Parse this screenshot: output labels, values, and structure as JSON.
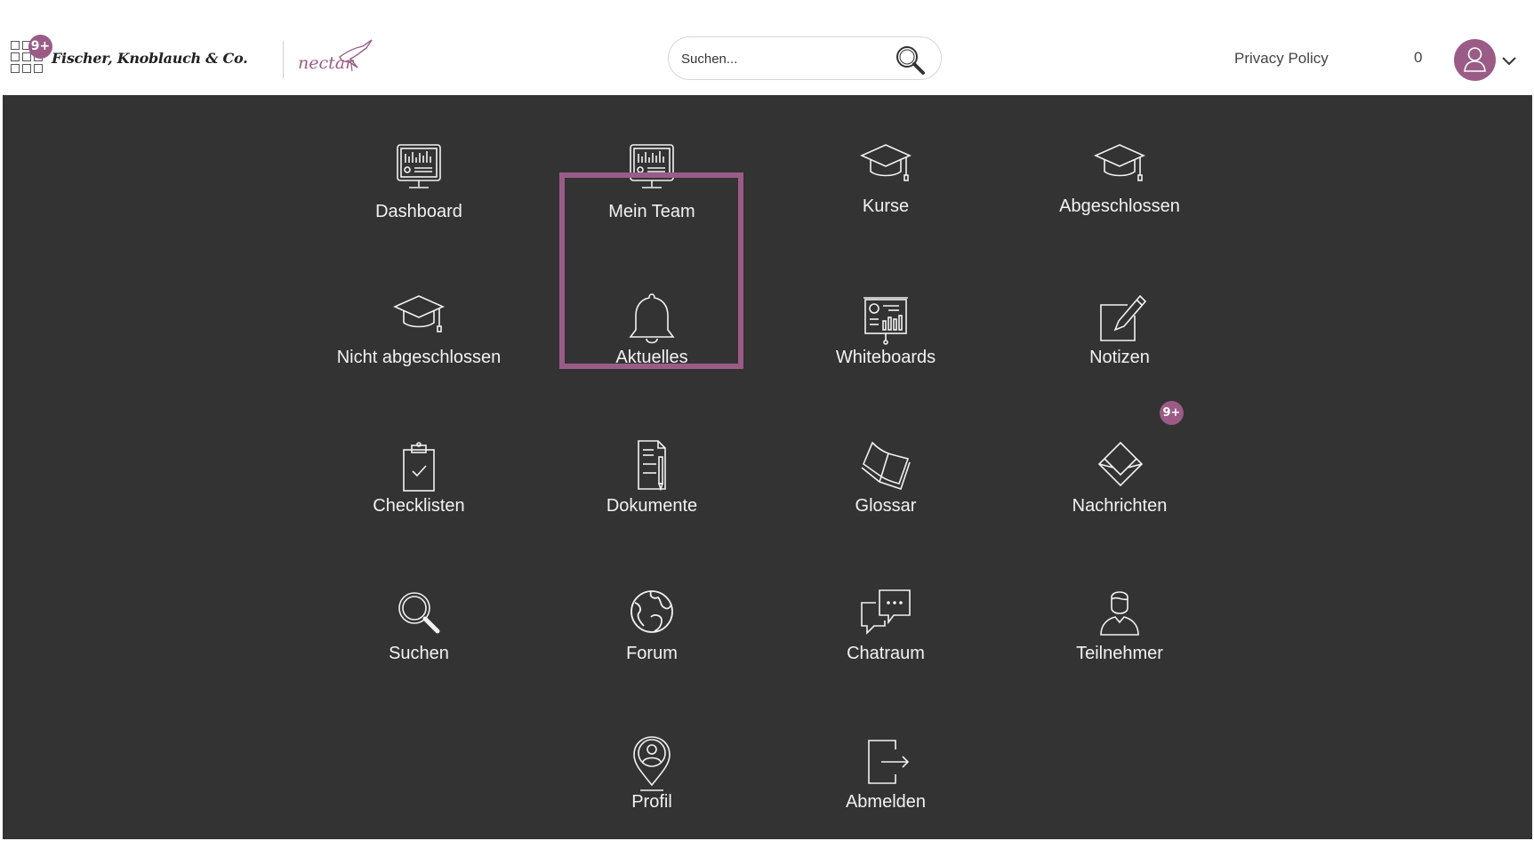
{
  "header": {
    "apps_badge": "9+",
    "company_name": "Fischer, Knoblauch & Co.",
    "brand_word": "nectar",
    "search": {
      "placeholder": "Suchen..."
    },
    "privacy_link": "Privacy Policy",
    "notification_count": "0"
  },
  "menu": {
    "items": [
      {
        "label": "Dashboard",
        "icon": "monitor-dashboard-icon"
      },
      {
        "label": "Mein Team",
        "icon": "monitor-dashboard-icon",
        "highlighted": true
      },
      {
        "label": "Kurse",
        "icon": "graduation-cap-icon"
      },
      {
        "label": "Abgeschlossen",
        "icon": "graduation-cap-icon"
      },
      {
        "label": "Nicht abgeschlossen",
        "icon": "graduation-cap-icon"
      },
      {
        "label": "Aktuelles",
        "icon": "bell-icon"
      },
      {
        "label": "Whiteboards",
        "icon": "whiteboard-icon"
      },
      {
        "label": "Notizen",
        "icon": "edit-note-icon"
      },
      {
        "label": "Checklisten",
        "icon": "clipboard-check-icon"
      },
      {
        "label": "Dokumente",
        "icon": "document-pen-icon"
      },
      {
        "label": "Glossar",
        "icon": "open-book-icon"
      },
      {
        "label": "Nachrichten",
        "icon": "envelope-icon",
        "badge": "9+"
      },
      {
        "label": "Suchen",
        "icon": "magnifier-icon"
      },
      {
        "label": "Forum",
        "icon": "globe-icon"
      },
      {
        "label": "Chatraum",
        "icon": "chat-bubbles-icon"
      },
      {
        "label": "Teilnehmer",
        "icon": "person-icon"
      },
      {
        "label": "Profil",
        "icon": "location-profile-icon"
      },
      {
        "label": "Abmelden",
        "icon": "logout-icon"
      }
    ]
  },
  "colors": {
    "accent": "#9a5c86",
    "menu_background": "#333333",
    "menu_text": "#f2f2f2"
  }
}
